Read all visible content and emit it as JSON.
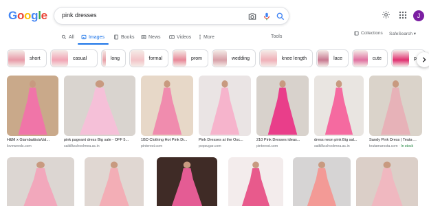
{
  "header": {
    "logo_letters": [
      {
        "ch": "G",
        "color": "#4285F4"
      },
      {
        "ch": "o",
        "color": "#EA4335"
      },
      {
        "ch": "o",
        "color": "#FBBC05"
      },
      {
        "ch": "g",
        "color": "#4285F4"
      },
      {
        "ch": "l",
        "color": "#34A853"
      },
      {
        "ch": "e",
        "color": "#EA4335"
      }
    ],
    "search_query": "pink dresses",
    "avatar_letter": "J"
  },
  "tabs": {
    "all": "All",
    "images": "Images",
    "books": "Books",
    "news": "News",
    "videos": "Videos",
    "more": "More",
    "tools": "Tools",
    "collections": "Collections",
    "safesearch": "SafeSearch"
  },
  "chips": [
    {
      "label": "short",
      "color": "#e89aa8"
    },
    {
      "label": "casual",
      "color": "#f2a4b4"
    },
    {
      "label": "long",
      "color": "#e8a0a8"
    },
    {
      "label": "formal",
      "color": "#f3c4c8"
    },
    {
      "label": "prom",
      "color": "#e88898"
    },
    {
      "label": "wedding",
      "color": "#d8a0a8"
    },
    {
      "label": "knee length",
      "color": "#f0b0b8"
    },
    {
      "label": "lace",
      "color": "#c87890"
    },
    {
      "label": "cute",
      "color": "#e070a0"
    },
    {
      "label": "pa",
      "color": "#e03070"
    }
  ],
  "results": [
    {
      "title": "H&M x GiambattistaVal...",
      "source": "loveweeds.com",
      "bg": "#c9a98a",
      "dress": "#f075a8"
    },
    {
      "title": "pink pageant dress Big sale - OFF 5...",
      "source": "saikilkschoolmea.ac.in",
      "bg": "#d9d4cf",
      "dress": "#f5c0d8"
    },
    {
      "title": "1BD Clothing Hot Pink Dr...",
      "source": "pinterest.com",
      "bg": "#e7d8c8",
      "dress": "#f08cae"
    },
    {
      "title": "Pink Dresses at the Osc...",
      "source": "popsugar.com",
      "bg": "#eae4e4",
      "dress": "#f6b4cc"
    },
    {
      "title": "210 Pink Dresses ideas...",
      "source": "pinterest.com",
      "bg": "#d8d2cc",
      "dress": "#e93e8a"
    },
    {
      "title": "dress neon pink Big sal...",
      "source": "saikilkschoolmea.ac.in",
      "bg": "#e9e5e1",
      "dress": "#f56aa0"
    },
    {
      "title": "Sandy Pink Dress | Teuta ...",
      "source": "teutamarosta.com",
      "instock": "In stock",
      "bg": "#dad3ca",
      "dress": "#e7b2b8"
    }
  ],
  "row2": [
    {
      "bg": "#dcd6d2",
      "dress": "#f2a8bc"
    },
    {
      "bg": "#e0d7d2",
      "dress": "#f3aeb6"
    },
    {
      "bg": "#3f2b26",
      "dress": "#e45c94"
    },
    {
      "bg": "#f3ecec",
      "dress": "#e85a8c"
    },
    {
      "bg": "#d6d4d4",
      "dress": "#f39a96"
    },
    {
      "bg": "#dbcfc8",
      "dress": "#f0b8c0"
    }
  ]
}
